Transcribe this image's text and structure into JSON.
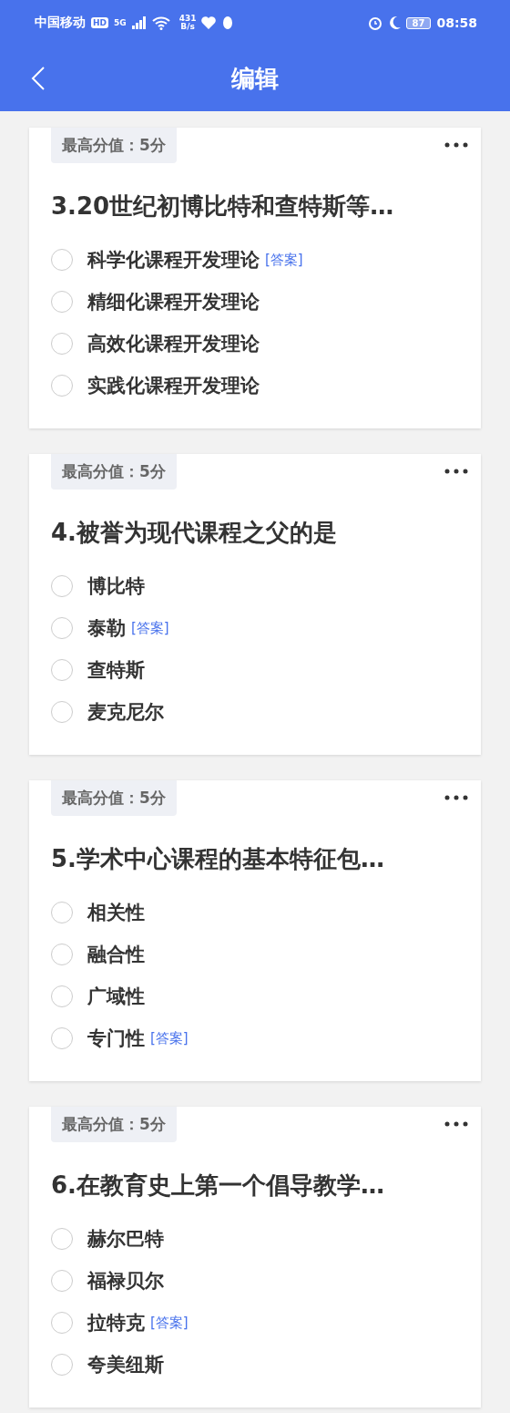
{
  "status_bar": {
    "carrier": "中国移动",
    "hd": "HD",
    "network": "5G",
    "speed_value": "431",
    "speed_unit": "B/s",
    "battery": "87",
    "time": "08:58"
  },
  "header": {
    "title": "编辑"
  },
  "questions": [
    {
      "score": "最高分值：5分",
      "title": "3.20世纪初博比特和查特斯等…",
      "options": [
        {
          "text": "科学化课程开发理论",
          "tag": "[答案]",
          "selected": false
        },
        {
          "text": "精细化课程开发理论",
          "selected": false
        },
        {
          "text": "高效化课程开发理论",
          "selected": false
        },
        {
          "text": "实践化课程开发理论",
          "selected": false
        }
      ]
    },
    {
      "score": "最高分值：5分",
      "title": "4.被誉为现代课程之父的是",
      "options": [
        {
          "text": "博比特",
          "selected": false
        },
        {
          "text": "泰勒",
          "tag": "[答案]",
          "selected": false
        },
        {
          "text": "查特斯",
          "selected": false
        },
        {
          "text": "麦克尼尔",
          "selected": false
        }
      ]
    },
    {
      "score": "最高分值：5分",
      "title": "5.学术中心课程的基本特征包…",
      "options": [
        {
          "text": "相关性",
          "selected": false
        },
        {
          "text": "融合性",
          "selected": false
        },
        {
          "text": "广域性",
          "selected": false
        },
        {
          "text": "专门性",
          "tag": "[答案]",
          "selected": false
        }
      ]
    },
    {
      "score": "最高分值：5分",
      "title": "6.在教育史上第一个倡导教学…",
      "options": [
        {
          "text": "赫尔巴特",
          "selected": false
        },
        {
          "text": "福禄贝尔",
          "selected": false
        },
        {
          "text": "拉特克",
          "tag": "[答案]",
          "selected": false
        },
        {
          "text": "夸美纽斯",
          "selected": false
        }
      ]
    }
  ]
}
